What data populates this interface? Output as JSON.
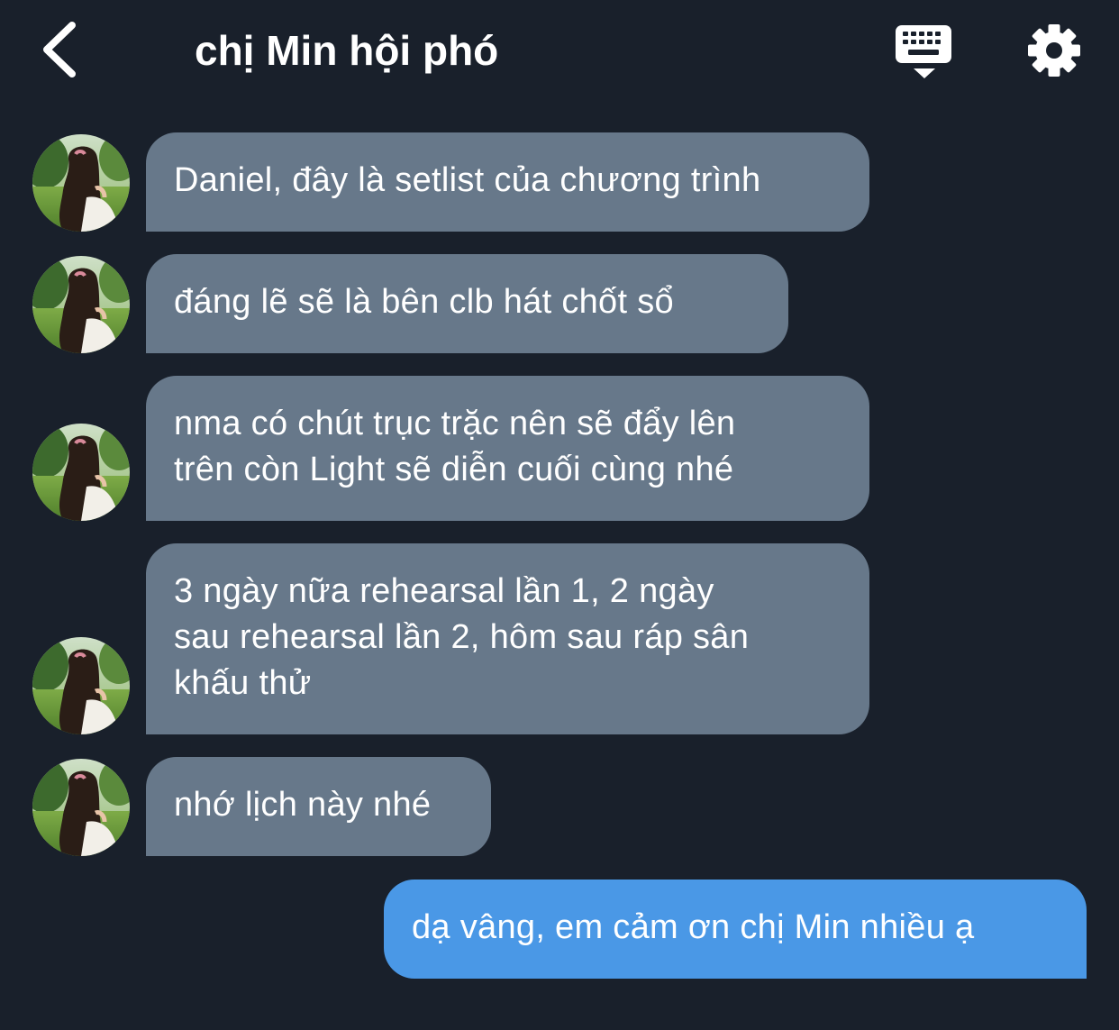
{
  "header": {
    "title": "chị Min hội phó",
    "back_icon": "chevron-left-icon",
    "keyboard_icon": "keyboard-icon",
    "settings_icon": "gear-icon"
  },
  "colors": {
    "background": "#19202b",
    "incoming_bubble": "#67788a",
    "outgoing_bubble": "#4a98e6",
    "text": "#ffffff"
  },
  "messages": [
    {
      "sender": "contact",
      "lines": [
        "Daniel, đây là setlist của chương trình"
      ]
    },
    {
      "sender": "contact",
      "lines": [
        "đáng lẽ sẽ là bên clb hát chốt sổ"
      ]
    },
    {
      "sender": "contact",
      "lines": [
        "nma có chút trục trặc nên sẽ đẩy lên",
        "trên còn Light sẽ diễn cuối cùng nhé"
      ]
    },
    {
      "sender": "contact",
      "lines": [
        "3 ngày nữa rehearsal lần 1, 2 ngày",
        "sau rehearsal lần 2, hôm sau ráp sân",
        "khấu thử"
      ]
    },
    {
      "sender": "contact",
      "lines": [
        "nhớ lịch này nhé"
      ]
    },
    {
      "sender": "me",
      "lines": [
        "dạ vâng, em cảm ơn chị Min nhiều ạ"
      ]
    }
  ]
}
